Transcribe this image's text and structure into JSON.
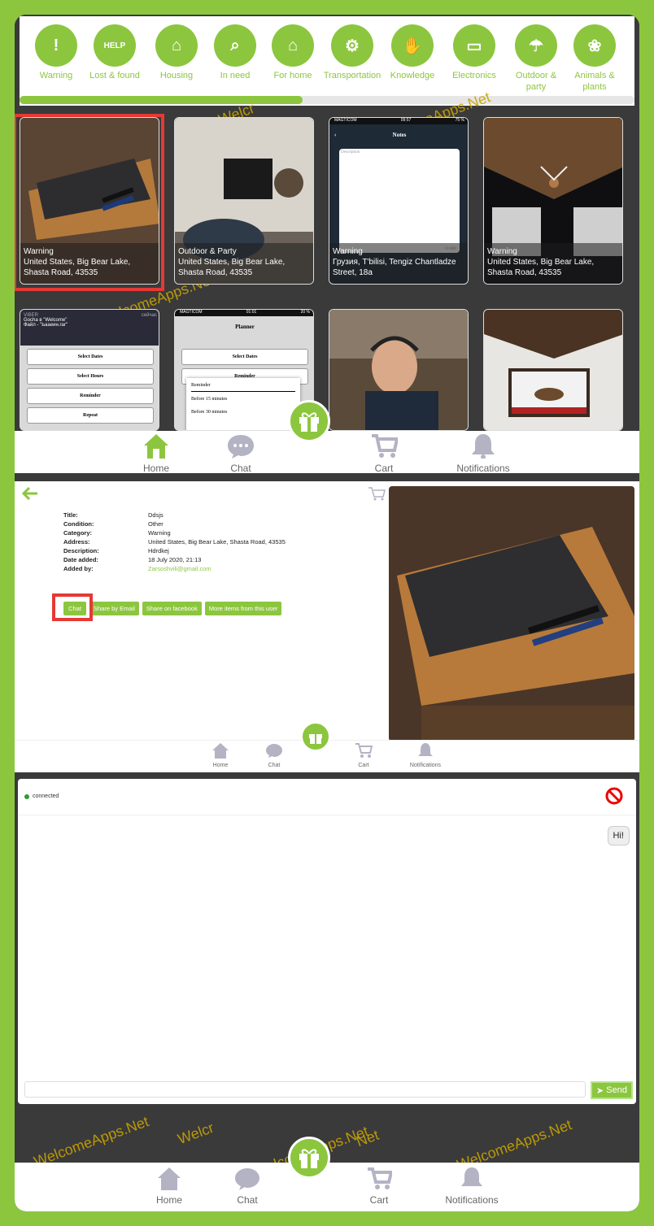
{
  "categories": [
    {
      "label": "Warning",
      "icon": "exclamation-icon"
    },
    {
      "label": "Lost & found",
      "icon": "help-icon"
    },
    {
      "label": "Housing",
      "icon": "house-hand-icon"
    },
    {
      "label": "In need",
      "icon": "search-box-icon"
    },
    {
      "label": "For home",
      "icon": "home-icon"
    },
    {
      "label": "Transportation",
      "icon": "car-wrench-icon"
    },
    {
      "label": "Knowledge",
      "icon": "handshake-icon"
    },
    {
      "label": "Electronics",
      "icon": "monitor-icon"
    },
    {
      "label": "Outdoor & party",
      "icon": "umbrella-table-icon"
    },
    {
      "label": "Animals & plants",
      "icon": "paw-icon"
    }
  ],
  "category_scroll_progress": 0.46,
  "listings": [
    {
      "category": "Warning",
      "location": "United States, Big Bear Lake, Shasta Road, 43535"
    },
    {
      "category": "Outdoor & Party",
      "location": "United States, Big Bear Lake, Shasta Road, 43535"
    },
    {
      "category": "Warning",
      "location": "Грузия, T'bilisi, Tengiz Chantladze Street, 18a"
    },
    {
      "category": "Warning",
      "location": "United States, Big Bear Lake, Shasta Road, 43535"
    }
  ],
  "listing_thumbs": [
    {
      "app": "VIBER",
      "time": "сейчас",
      "title": "Gocha в \"Welcome\"",
      "sub": "Файл - \"Ьааеин.rar\"",
      "rows": [
        "Select Dates",
        "Select Hours",
        "Reminder",
        "Repeat"
      ]
    },
    {
      "carrier": "MAGTICOM",
      "time": "01:01",
      "battery": "20 %",
      "header": "Planner",
      "rows": [
        "Select Dates",
        "Reminder"
      ],
      "popup": [
        "Reminder",
        "Before 15 minutes",
        "Before 30 minutes"
      ]
    },
    {
      "thumb": "man-with-headset-photo"
    },
    {
      "thumb": "california-flag-room-photo"
    }
  ],
  "notes_thumb": {
    "carrier": "MAGTICOM",
    "time": "09:57",
    "battery": "75 %",
    "title": "Notes",
    "placeholder": "Description",
    "counter": "0/1000"
  },
  "nav": {
    "home": "Home",
    "chat": "Chat",
    "cart": "Cart",
    "notifications": "Notifications"
  },
  "detail": {
    "fields": [
      {
        "key": "Title:",
        "value": "Ddsjs"
      },
      {
        "key": "Condition:",
        "value": "Other"
      },
      {
        "key": "Category:",
        "value": "Warning"
      },
      {
        "key": "Address:",
        "value": "United States, Big Bear Lake, Shasta Road, 43535"
      },
      {
        "key": "Description:",
        "value": "Hdrdkej"
      },
      {
        "key": "Date added:",
        "value": "18 July 2020, 21:13"
      },
      {
        "key": "Added by:",
        "value": "Zarsoshvili@gmail.com"
      }
    ],
    "buttons": {
      "chat": "Chat",
      "email": "Share by Email",
      "facebook": "Share on facebook",
      "more": "More items from this user"
    }
  },
  "chat": {
    "status": "connected",
    "messages": [
      "Hi!"
    ],
    "send": "Send",
    "input_value": ""
  },
  "watermark": [
    "WelcomeApps.Net",
    "WelcomeApps.Net",
    "WelcomeApps.Net",
    "Welcr",
    "Net"
  ],
  "colors": {
    "accent": "#8cc63f",
    "highlight": "#e53935",
    "background": "#3a3a3a"
  }
}
